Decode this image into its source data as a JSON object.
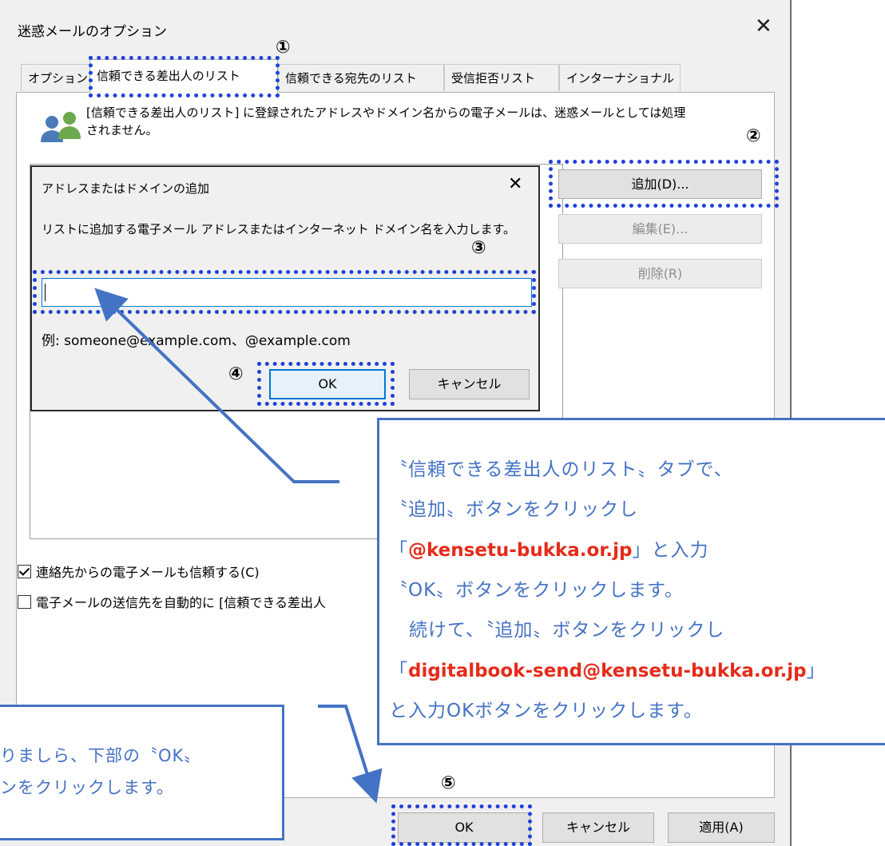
{
  "main_dialog": {
    "title": "迷惑メールのオプション",
    "close_glyph": "✕",
    "tabs": [
      {
        "label": "オプション",
        "active": false
      },
      {
        "label": "信頼できる差出人のリスト",
        "active": true
      },
      {
        "label": "信頼できる宛先のリスト",
        "active": false
      },
      {
        "label": "受信拒否リスト",
        "active": false
      },
      {
        "label": "インターナショナル",
        "active": false
      }
    ],
    "info_text": "[信頼できる差出人のリスト] に登録されたアドレスやドメイン名からの電子メールは、迷惑メールとしては処理されません。",
    "side_buttons": {
      "add": "追加(D)...",
      "edit": "編集(E)...",
      "delete": "削除(R)"
    },
    "checkboxes": [
      {
        "label": "連絡先からの電子メールも信頼する(C)",
        "checked": true
      },
      {
        "label": "電子メールの送信先を自動的に [信頼できる差出人",
        "checked": false
      }
    ],
    "bottom_buttons": {
      "ok": "OK",
      "cancel": "キャンセル",
      "apply": "適用(A)"
    }
  },
  "sub_dialog": {
    "title": "アドレスまたはドメインの追加",
    "close_glyph": "✕",
    "instruction": "リストに追加する電子メール アドレスまたはインターネット ドメイン名を入力します。",
    "input_value": "",
    "example": "例: someone@example.com、@example.com",
    "ok": "OK",
    "cancel": "キャンセル"
  },
  "step_numbers": [
    "①",
    "②",
    "③",
    "④",
    "⑤"
  ],
  "callout_right": {
    "line1": "〝信頼できる差出人のリスト〟タブで、",
    "line2": "〝追加〟ボタンをクリックし",
    "line3_pre": "「",
    "line3_red": "@kensetu-bukka.or.jp",
    "line3_post": "」と入力",
    "line4": "〝OK〟ボタンをクリックします。",
    "line5": "続けて、〝追加〟ボタンをクリックし",
    "line6_pre": "「",
    "line6_red": "digitalbook-send@kensetu-bukka.or.jp",
    "line6_post": "」",
    "line7": "と入力OKボタンをクリックします。"
  },
  "callout_left": {
    "line1": "りましら、下部の〝OK〟",
    "line2": "ンをクリックします。"
  },
  "colors": {
    "highlight": "#2042d8",
    "callout_text": "#4472c4",
    "emphasis_red": "#e52b1a",
    "dialog_bg": "#f0f0f0",
    "focus_blue": "#0078d7"
  }
}
